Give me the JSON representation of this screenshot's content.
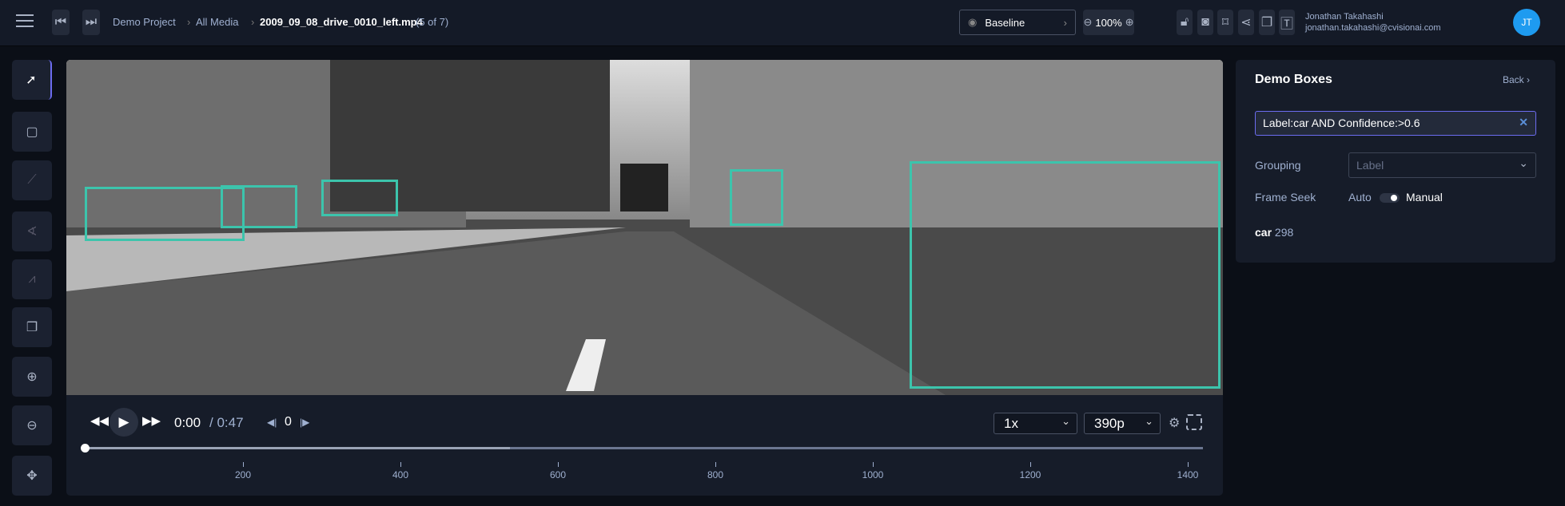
{
  "header": {
    "breadcrumb": [
      "Demo Project",
      "All Media"
    ],
    "file": "2009_09_08_drive_0010_left.mp4",
    "position": "(5 of 7)",
    "view": "Baseline",
    "zoom": "100%",
    "user_name": "Jonathan Takahashi",
    "user_email": "jonathan.takahashi@cvisionai.com",
    "avatar": "JT"
  },
  "player": {
    "current_time": "0:00",
    "duration": "/ 0:47",
    "frame": "0",
    "speed": "1x",
    "quality": "390p",
    "buffered_fraction": 0.38,
    "timeline_ticks": [
      "200",
      "400",
      "600",
      "800",
      "1000",
      "1200",
      "1400"
    ]
  },
  "panel": {
    "title": "Demo Boxes",
    "back": "Back",
    "search_value": "Label:car AND Confidence:>0.6",
    "grouping_label": "Grouping",
    "grouping_value": "Label",
    "frame_seek_label": "Frame Seek",
    "seek_auto": "Auto",
    "seek_manual": "Manual",
    "result_label": "car",
    "result_count": "298"
  },
  "colors": {
    "box": "#3cc4ac",
    "accent": "#6c6cf0",
    "avatar": "#1e9bf0"
  }
}
